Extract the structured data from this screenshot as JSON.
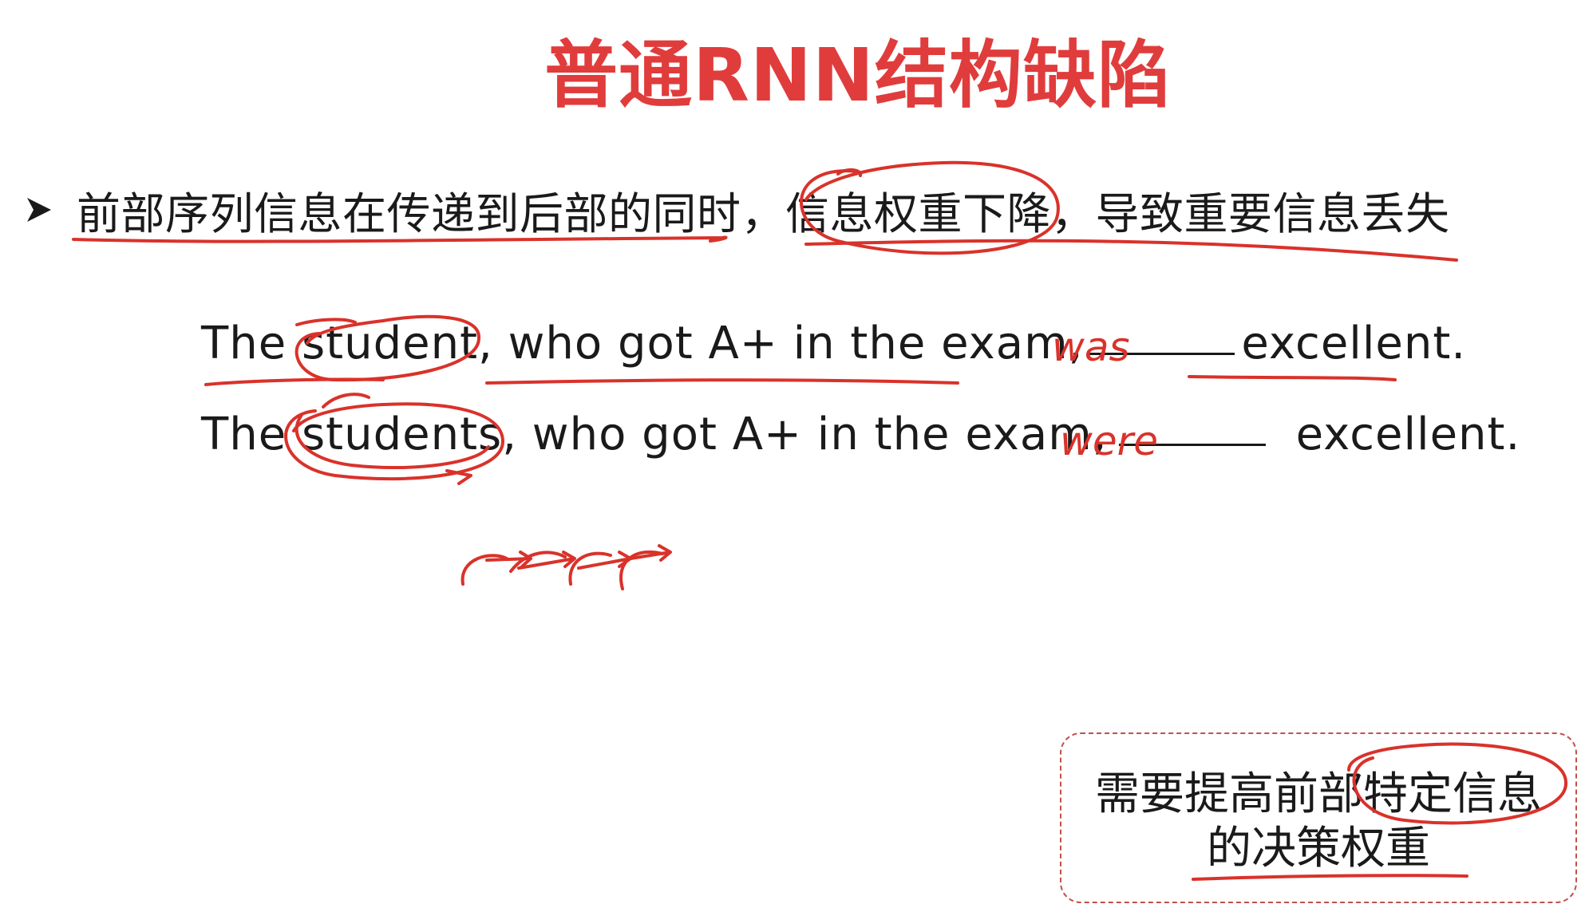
{
  "slide": {
    "title": "普通RNN结构缺陷",
    "bullet": "前部序列信息在传递到后部的同时，信息权重下降，导致重要信息丢失",
    "sentence1": {
      "before": "The student, who got A+ in the exam,",
      "after": "excellent.",
      "handwritten": "was"
    },
    "sentence2": {
      "before": "The students, who got A+ in the exam,",
      "after": "excellent.",
      "handwritten": "were"
    },
    "note": {
      "line1": "需要提高前部特定信息",
      "line2": "的决策权重"
    }
  },
  "colors": {
    "title": "#e03c3c",
    "ink": "#d9322a",
    "text": "#1a1a1a",
    "box_border": "#c0504d"
  }
}
